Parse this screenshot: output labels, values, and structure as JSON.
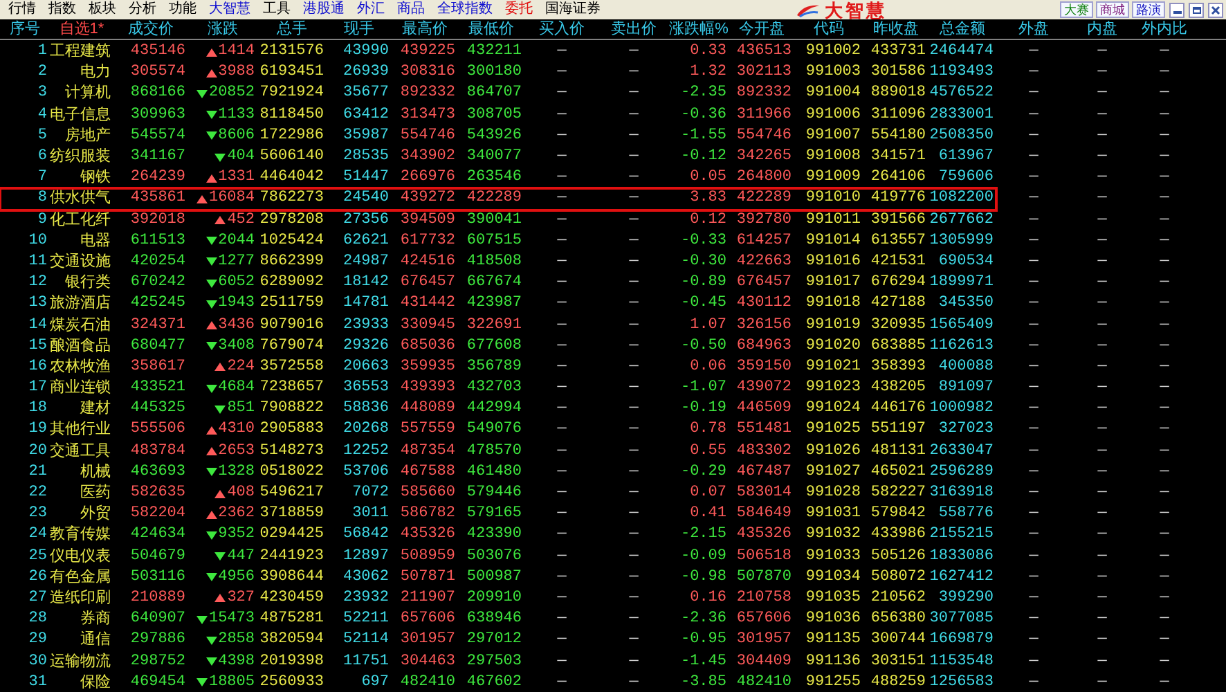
{
  "menu": [
    {
      "label": "行情",
      "color": "#000000"
    },
    {
      "label": "指数",
      "color": "#000000"
    },
    {
      "label": "板块",
      "color": "#000000"
    },
    {
      "label": "分析",
      "color": "#000000"
    },
    {
      "label": "功能",
      "color": "#000000"
    },
    {
      "label": "大智慧",
      "color": "#1010d0"
    },
    {
      "label": "工具",
      "color": "#000000"
    },
    {
      "label": "港股通",
      "color": "#1010d0"
    },
    {
      "label": "外汇",
      "color": "#1010d0"
    },
    {
      "label": "商品",
      "color": "#1010d0"
    },
    {
      "label": "全球指数",
      "color": "#1010d0"
    },
    {
      "label": "委托",
      "color": "#e01010"
    },
    {
      "label": "国海证券",
      "color": "#000000"
    }
  ],
  "logo": "大智慧",
  "top_buttons": [
    "大赛",
    "商城",
    "路演"
  ],
  "columns": [
    "序号",
    "自选1*",
    "成交价",
    "涨跌",
    "总手",
    "现手",
    "最高价",
    "最低价",
    "买入价",
    "卖出价",
    "涨跌幅%",
    "今开盘",
    "代码",
    "昨收盘",
    "总金额",
    "外盘",
    "内盘",
    "外内比"
  ],
  "rows": [
    {
      "cells": [
        "1",
        "工程建筑",
        "435146",
        "1414",
        "2131576",
        "43990",
        "439225",
        "432211",
        "—",
        "—",
        "0.33",
        "436513",
        "991002",
        "433731",
        "2464474",
        "—",
        "—",
        "—"
      ],
      "up": true,
      "open_up": true,
      "high_up": true,
      "low_up": false,
      "selected": false
    },
    {
      "cells": [
        "2",
        "电力",
        "305574",
        "3988",
        "6193451",
        "26939",
        "308316",
        "300180",
        "—",
        "—",
        "1.32",
        "302113",
        "991003",
        "301586",
        "1193493",
        "—",
        "—",
        "—"
      ],
      "up": true,
      "open_up": true,
      "high_up": true,
      "low_up": false,
      "selected": false
    },
    {
      "cells": [
        "3",
        "计算机",
        "868166",
        "20852",
        "7921924",
        "35677",
        "892332",
        "864707",
        "—",
        "—",
        "-2.35",
        "892332",
        "991004",
        "889018",
        "4576522",
        "—",
        "—",
        "—"
      ],
      "up": false,
      "open_up": true,
      "high_up": true,
      "low_up": false,
      "selected": false
    },
    {
      "cells": [
        "4",
        "电子信息",
        "309963",
        "1133",
        "8118450",
        "63412",
        "313473",
        "308705",
        "—",
        "—",
        "-0.36",
        "311966",
        "991006",
        "311096",
        "2833001",
        "—",
        "—",
        "—"
      ],
      "up": false,
      "open_up": true,
      "high_up": true,
      "low_up": false,
      "selected": false
    },
    {
      "cells": [
        "5",
        "房地产",
        "545574",
        "8606",
        "1722986",
        "35987",
        "554746",
        "543926",
        "—",
        "—",
        "-1.55",
        "554746",
        "991007",
        "554180",
        "2508350",
        "—",
        "—",
        "—"
      ],
      "up": false,
      "open_up": true,
      "high_up": true,
      "low_up": false,
      "selected": false
    },
    {
      "cells": [
        "6",
        "纺织服装",
        "341167",
        "404",
        "5606140",
        "28535",
        "343902",
        "340077",
        "—",
        "—",
        "-0.12",
        "342265",
        "991008",
        "341571",
        "613967",
        "—",
        "—",
        "—"
      ],
      "up": false,
      "open_up": true,
      "high_up": true,
      "low_up": false,
      "selected": false
    },
    {
      "cells": [
        "7",
        "钢铁",
        "264239",
        "1331",
        "4464042",
        "51447",
        "266976",
        "263546",
        "—",
        "—",
        "0.05",
        "264800",
        "991009",
        "264106",
        "759606",
        "—",
        "—",
        "—"
      ],
      "up": true,
      "open_up": true,
      "high_up": true,
      "low_up": false,
      "selected": false
    },
    {
      "cells": [
        "8",
        "供水供气",
        "435861",
        "16084",
        "7862273",
        "24540",
        "439272",
        "422289",
        "—",
        "—",
        "3.83",
        "422289",
        "991010",
        "419776",
        "1082200",
        "—",
        "—",
        "—"
      ],
      "up": true,
      "open_up": true,
      "high_up": true,
      "low_up": true,
      "selected": true
    },
    {
      "cells": [
        "9",
        "化工化纤",
        "392018",
        "452",
        "2978208",
        "27356",
        "394509",
        "390041",
        "—",
        "—",
        "0.12",
        "392780",
        "991011",
        "391566",
        "2677662",
        "—",
        "—",
        "—"
      ],
      "up": true,
      "open_up": true,
      "high_up": true,
      "low_up": false,
      "selected": false
    },
    {
      "cells": [
        "10",
        "电器",
        "611513",
        "2044",
        "1025424",
        "62621",
        "617732",
        "607515",
        "—",
        "—",
        "-0.33",
        "614257",
        "991014",
        "613557",
        "1305999",
        "—",
        "—",
        "—"
      ],
      "up": false,
      "open_up": true,
      "high_up": true,
      "low_up": false,
      "selected": false
    },
    {
      "cells": [
        "11",
        "交通设施",
        "420254",
        "1277",
        "8662399",
        "24987",
        "424516",
        "418508",
        "—",
        "—",
        "-0.30",
        "422663",
        "991016",
        "421531",
        "690534",
        "—",
        "—",
        "—"
      ],
      "up": false,
      "open_up": true,
      "high_up": true,
      "low_up": false,
      "selected": false
    },
    {
      "cells": [
        "12",
        "银行类",
        "670242",
        "6052",
        "6289092",
        "18142",
        "676457",
        "667674",
        "—",
        "—",
        "-0.89",
        "676457",
        "991017",
        "676294",
        "1899971",
        "—",
        "—",
        "—"
      ],
      "up": false,
      "open_up": true,
      "high_up": true,
      "low_up": false,
      "selected": false
    },
    {
      "cells": [
        "13",
        "旅游酒店",
        "425245",
        "1943",
        "2511759",
        "14781",
        "431442",
        "423987",
        "—",
        "—",
        "-0.45",
        "430112",
        "991018",
        "427188",
        "345350",
        "—",
        "—",
        "—"
      ],
      "up": false,
      "open_up": true,
      "high_up": true,
      "low_up": false,
      "selected": false
    },
    {
      "cells": [
        "14",
        "煤炭石油",
        "324371",
        "3436",
        "9079016",
        "23933",
        "330945",
        "322691",
        "—",
        "—",
        "1.07",
        "326156",
        "991019",
        "320935",
        "1565409",
        "—",
        "—",
        "—"
      ],
      "up": true,
      "open_up": true,
      "high_up": true,
      "low_up": true,
      "selected": false
    },
    {
      "cells": [
        "15",
        "酿酒食品",
        "680477",
        "3408",
        "7679074",
        "29326",
        "685036",
        "677608",
        "—",
        "—",
        "-0.50",
        "684963",
        "991020",
        "683885",
        "1162613",
        "—",
        "—",
        "—"
      ],
      "up": false,
      "open_up": true,
      "high_up": true,
      "low_up": false,
      "selected": false
    },
    {
      "cells": [
        "16",
        "农林牧渔",
        "358617",
        "224",
        "3572558",
        "20663",
        "359935",
        "356789",
        "—",
        "—",
        "0.06",
        "359150",
        "991021",
        "358393",
        "400088",
        "—",
        "—",
        "—"
      ],
      "up": true,
      "open_up": true,
      "high_up": true,
      "low_up": false,
      "selected": false
    },
    {
      "cells": [
        "17",
        "商业连锁",
        "433521",
        "4684",
        "7238657",
        "36553",
        "439393",
        "432703",
        "—",
        "—",
        "-1.07",
        "439072",
        "991023",
        "438205",
        "891097",
        "—",
        "—",
        "—"
      ],
      "up": false,
      "open_up": true,
      "high_up": true,
      "low_up": false,
      "selected": false
    },
    {
      "cells": [
        "18",
        "建材",
        "445325",
        "851",
        "7908822",
        "58836",
        "448089",
        "442994",
        "—",
        "—",
        "-0.19",
        "446509",
        "991024",
        "446176",
        "1000982",
        "—",
        "—",
        "—"
      ],
      "up": false,
      "open_up": true,
      "high_up": true,
      "low_up": false,
      "selected": false
    },
    {
      "cells": [
        "19",
        "其他行业",
        "555506",
        "4310",
        "2905883",
        "20268",
        "557559",
        "549076",
        "—",
        "—",
        "0.78",
        "551481",
        "991025",
        "551197",
        "327023",
        "—",
        "—",
        "—"
      ],
      "up": true,
      "open_up": true,
      "high_up": true,
      "low_up": false,
      "selected": false
    },
    {
      "cells": [
        "20",
        "交通工具",
        "483784",
        "2653",
        "5148273",
        "12252",
        "487354",
        "478570",
        "—",
        "—",
        "0.55",
        "483302",
        "991026",
        "481131",
        "2633047",
        "—",
        "—",
        "—"
      ],
      "up": true,
      "open_up": true,
      "high_up": true,
      "low_up": false,
      "selected": false
    },
    {
      "cells": [
        "21",
        "机械",
        "463693",
        "1328",
        "0518022",
        "53706",
        "467588",
        "461480",
        "—",
        "—",
        "-0.29",
        "467487",
        "991027",
        "465021",
        "2596289",
        "—",
        "—",
        "—"
      ],
      "up": false,
      "open_up": true,
      "high_up": true,
      "low_up": false,
      "selected": false
    },
    {
      "cells": [
        "22",
        "医药",
        "582635",
        "408",
        "5496217",
        "7072",
        "585660",
        "579446",
        "—",
        "—",
        "0.07",
        "583014",
        "991028",
        "582227",
        "3163918",
        "—",
        "—",
        "—"
      ],
      "up": true,
      "open_up": true,
      "high_up": true,
      "low_up": false,
      "selected": false
    },
    {
      "cells": [
        "23",
        "外贸",
        "582204",
        "2362",
        "3718859",
        "3011",
        "586782",
        "579165",
        "—",
        "—",
        "0.41",
        "584649",
        "991031",
        "579842",
        "558776",
        "—",
        "—",
        "—"
      ],
      "up": true,
      "open_up": true,
      "high_up": true,
      "low_up": false,
      "selected": false
    },
    {
      "cells": [
        "24",
        "教育传媒",
        "424634",
        "9352",
        "0294425",
        "56842",
        "435326",
        "423390",
        "—",
        "—",
        "-2.15",
        "435326",
        "991032",
        "433986",
        "2155215",
        "—",
        "—",
        "—"
      ],
      "up": false,
      "open_up": true,
      "high_up": true,
      "low_up": false,
      "selected": false
    },
    {
      "cells": [
        "25",
        "仪电仪表",
        "504679",
        "447",
        "2441923",
        "12897",
        "508959",
        "503076",
        "—",
        "—",
        "-0.09",
        "506518",
        "991033",
        "505126",
        "1833086",
        "—",
        "—",
        "—"
      ],
      "up": false,
      "open_up": true,
      "high_up": true,
      "low_up": false,
      "selected": false
    },
    {
      "cells": [
        "26",
        "有色金属",
        "503116",
        "4956",
        "3908644",
        "43062",
        "507871",
        "500987",
        "—",
        "—",
        "-0.98",
        "507870",
        "991034",
        "508072",
        "1627412",
        "—",
        "—",
        "—"
      ],
      "up": false,
      "open_up": false,
      "high_up": true,
      "low_up": false,
      "selected": false
    },
    {
      "cells": [
        "27",
        "造纸印刷",
        "210889",
        "327",
        "4230459",
        "23932",
        "211907",
        "209910",
        "—",
        "—",
        "0.16",
        "210758",
        "991035",
        "210562",
        "399290",
        "—",
        "—",
        "—"
      ],
      "up": true,
      "open_up": true,
      "high_up": true,
      "low_up": false,
      "selected": false
    },
    {
      "cells": [
        "28",
        "券商",
        "640907",
        "15473",
        "4875281",
        "52211",
        "657606",
        "638946",
        "—",
        "—",
        "-2.36",
        "657606",
        "991036",
        "656380",
        "3077085",
        "—",
        "—",
        "—"
      ],
      "up": false,
      "open_up": true,
      "high_up": true,
      "low_up": false,
      "selected": false
    },
    {
      "cells": [
        "29",
        "通信",
        "297886",
        "2858",
        "3820594",
        "52114",
        "301957",
        "297012",
        "—",
        "—",
        "-0.95",
        "301957",
        "991135",
        "300744",
        "1669879",
        "—",
        "—",
        "—"
      ],
      "up": false,
      "open_up": true,
      "high_up": true,
      "low_up": false,
      "selected": false
    },
    {
      "cells": [
        "30",
        "运输物流",
        "298752",
        "4398",
        "2019398",
        "11751",
        "304463",
        "297503",
        "—",
        "—",
        "-1.45",
        "304409",
        "991136",
        "303151",
        "1153548",
        "—",
        "—",
        "—"
      ],
      "up": false,
      "open_up": true,
      "high_up": true,
      "low_up": false,
      "selected": false
    },
    {
      "cells": [
        "31",
        "保险",
        "469454",
        "18805",
        "2560933",
        "697",
        "482410",
        "467602",
        "—",
        "—",
        "-3.85",
        "482410",
        "991255",
        "488259",
        "1256583",
        "—",
        "—",
        "—"
      ],
      "up": false,
      "open_up": false,
      "high_up": false,
      "low_up": false,
      "selected": false
    }
  ]
}
